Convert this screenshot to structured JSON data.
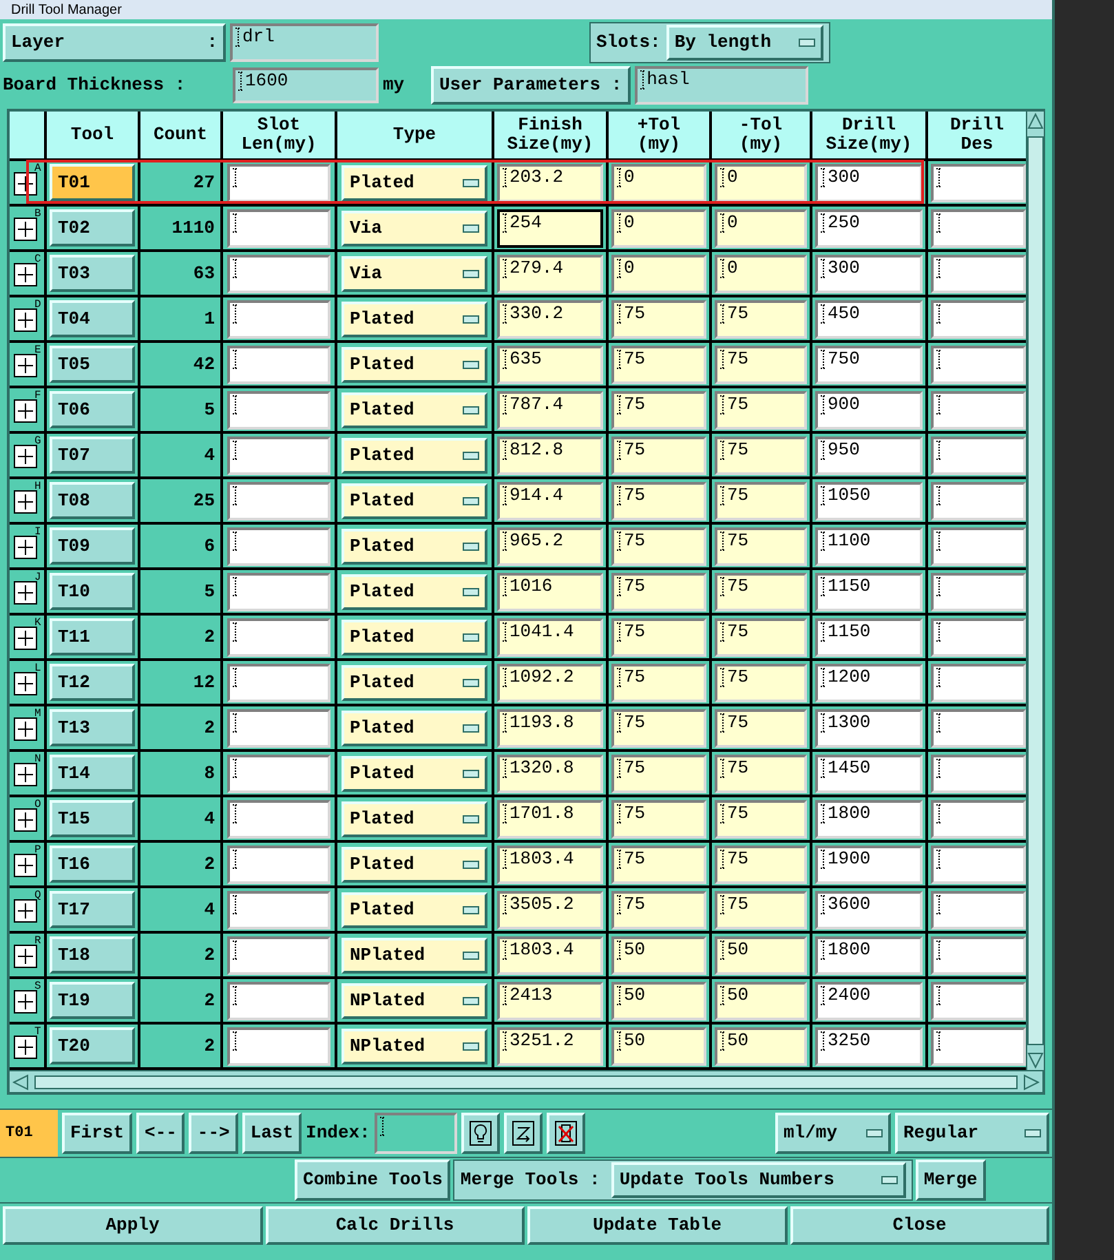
{
  "window": {
    "title": "Drill Tool Manager"
  },
  "layer": {
    "label": "Layer",
    "colon": ":",
    "value": "drl"
  },
  "slots": {
    "label": "Slots:",
    "value": "By length"
  },
  "thickness": {
    "label": "Board Thickness :",
    "value": "1600",
    "unit": "my"
  },
  "user_parameters": {
    "label": "User Parameters :",
    "value": "hasl"
  },
  "table": {
    "columns": [
      "Tool",
      "Count",
      "Slot Len(my)",
      "Type",
      "Finish Size(my)",
      "+Tol (my)",
      "-Tol (my)",
      "Drill Size(my)",
      "Drill Des"
    ],
    "rows": [
      {
        "marker": "A",
        "tool": "T01",
        "selected": true,
        "count": "27",
        "type": "Plated",
        "finish": "203.2",
        "plus_tol": "0",
        "minus_tol": "0",
        "drill_size": "300",
        "focused": false
      },
      {
        "marker": "B",
        "tool": "T02",
        "selected": false,
        "count": "1110",
        "type": "Via",
        "finish": "254",
        "plus_tol": "0",
        "minus_tol": "0",
        "drill_size": "250",
        "focused": true
      },
      {
        "marker": "C",
        "tool": "T03",
        "selected": false,
        "count": "63",
        "type": "Via",
        "finish": "279.4",
        "plus_tol": "0",
        "minus_tol": "0",
        "drill_size": "300",
        "focused": false
      },
      {
        "marker": "D",
        "tool": "T04",
        "selected": false,
        "count": "1",
        "type": "Plated",
        "finish": "330.2",
        "plus_tol": "75",
        "minus_tol": "75",
        "drill_size": "450",
        "focused": false
      },
      {
        "marker": "E",
        "tool": "T05",
        "selected": false,
        "count": "42",
        "type": "Plated",
        "finish": "635",
        "plus_tol": "75",
        "minus_tol": "75",
        "drill_size": "750",
        "focused": false
      },
      {
        "marker": "F",
        "tool": "T06",
        "selected": false,
        "count": "5",
        "type": "Plated",
        "finish": "787.4",
        "plus_tol": "75",
        "minus_tol": "75",
        "drill_size": "900",
        "focused": false
      },
      {
        "marker": "G",
        "tool": "T07",
        "selected": false,
        "count": "4",
        "type": "Plated",
        "finish": "812.8",
        "plus_tol": "75",
        "minus_tol": "75",
        "drill_size": "950",
        "focused": false
      },
      {
        "marker": "H",
        "tool": "T08",
        "selected": false,
        "count": "25",
        "type": "Plated",
        "finish": "914.4",
        "plus_tol": "75",
        "minus_tol": "75",
        "drill_size": "1050",
        "focused": false
      },
      {
        "marker": "I",
        "tool": "T09",
        "selected": false,
        "count": "6",
        "type": "Plated",
        "finish": "965.2",
        "plus_tol": "75",
        "minus_tol": "75",
        "drill_size": "1100",
        "focused": false
      },
      {
        "marker": "J",
        "tool": "T10",
        "selected": false,
        "count": "5",
        "type": "Plated",
        "finish": "1016",
        "plus_tol": "75",
        "minus_tol": "75",
        "drill_size": "1150",
        "focused": false
      },
      {
        "marker": "K",
        "tool": "T11",
        "selected": false,
        "count": "2",
        "type": "Plated",
        "finish": "1041.4",
        "plus_tol": "75",
        "minus_tol": "75",
        "drill_size": "1150",
        "focused": false
      },
      {
        "marker": "L",
        "tool": "T12",
        "selected": false,
        "count": "12",
        "type": "Plated",
        "finish": "1092.2",
        "plus_tol": "75",
        "minus_tol": "75",
        "drill_size": "1200",
        "focused": false
      },
      {
        "marker": "M",
        "tool": "T13",
        "selected": false,
        "count": "2",
        "type": "Plated",
        "finish": "1193.8",
        "plus_tol": "75",
        "minus_tol": "75",
        "drill_size": "1300",
        "focused": false
      },
      {
        "marker": "N",
        "tool": "T14",
        "selected": false,
        "count": "8",
        "type": "Plated",
        "finish": "1320.8",
        "plus_tol": "75",
        "minus_tol": "75",
        "drill_size": "1450",
        "focused": false
      },
      {
        "marker": "O",
        "tool": "T15",
        "selected": false,
        "count": "4",
        "type": "Plated",
        "finish": "1701.8",
        "plus_tol": "75",
        "minus_tol": "75",
        "drill_size": "1800",
        "focused": false
      },
      {
        "marker": "P",
        "tool": "T16",
        "selected": false,
        "count": "2",
        "type": "Plated",
        "finish": "1803.4",
        "plus_tol": "75",
        "minus_tol": "75",
        "drill_size": "1900",
        "focused": false
      },
      {
        "marker": "Q",
        "tool": "T17",
        "selected": false,
        "count": "4",
        "type": "Plated",
        "finish": "3505.2",
        "plus_tol": "75",
        "minus_tol": "75",
        "drill_size": "3600",
        "focused": false
      },
      {
        "marker": "R",
        "tool": "T18",
        "selected": false,
        "count": "2",
        "type": "NPlated",
        "finish": "1803.4",
        "plus_tol": "50",
        "minus_tol": "50",
        "drill_size": "1800",
        "focused": false
      },
      {
        "marker": "S",
        "tool": "T19",
        "selected": false,
        "count": "2",
        "type": "NPlated",
        "finish": "2413",
        "plus_tol": "50",
        "minus_tol": "50",
        "drill_size": "2400",
        "focused": false
      },
      {
        "marker": "T",
        "tool": "T20",
        "selected": false,
        "count": "2",
        "type": "NPlated",
        "finish": "3251.2",
        "plus_tol": "50",
        "minus_tol": "50",
        "drill_size": "3250",
        "focused": false
      }
    ]
  },
  "toolbar": {
    "current": "T01",
    "buttons": [
      "First",
      "<--",
      "-->",
      "Last"
    ],
    "index_label": "Index:",
    "units": "ml/my",
    "mode": "Regular"
  },
  "merge_bar": {
    "combine": "Combine Tools",
    "merge_label": "Merge Tools :",
    "merge_mode": "Update Tools Numbers",
    "merge": "Merge"
  },
  "actions": [
    "Apply",
    "Calc Drills",
    "Update Table",
    "Close"
  ]
}
